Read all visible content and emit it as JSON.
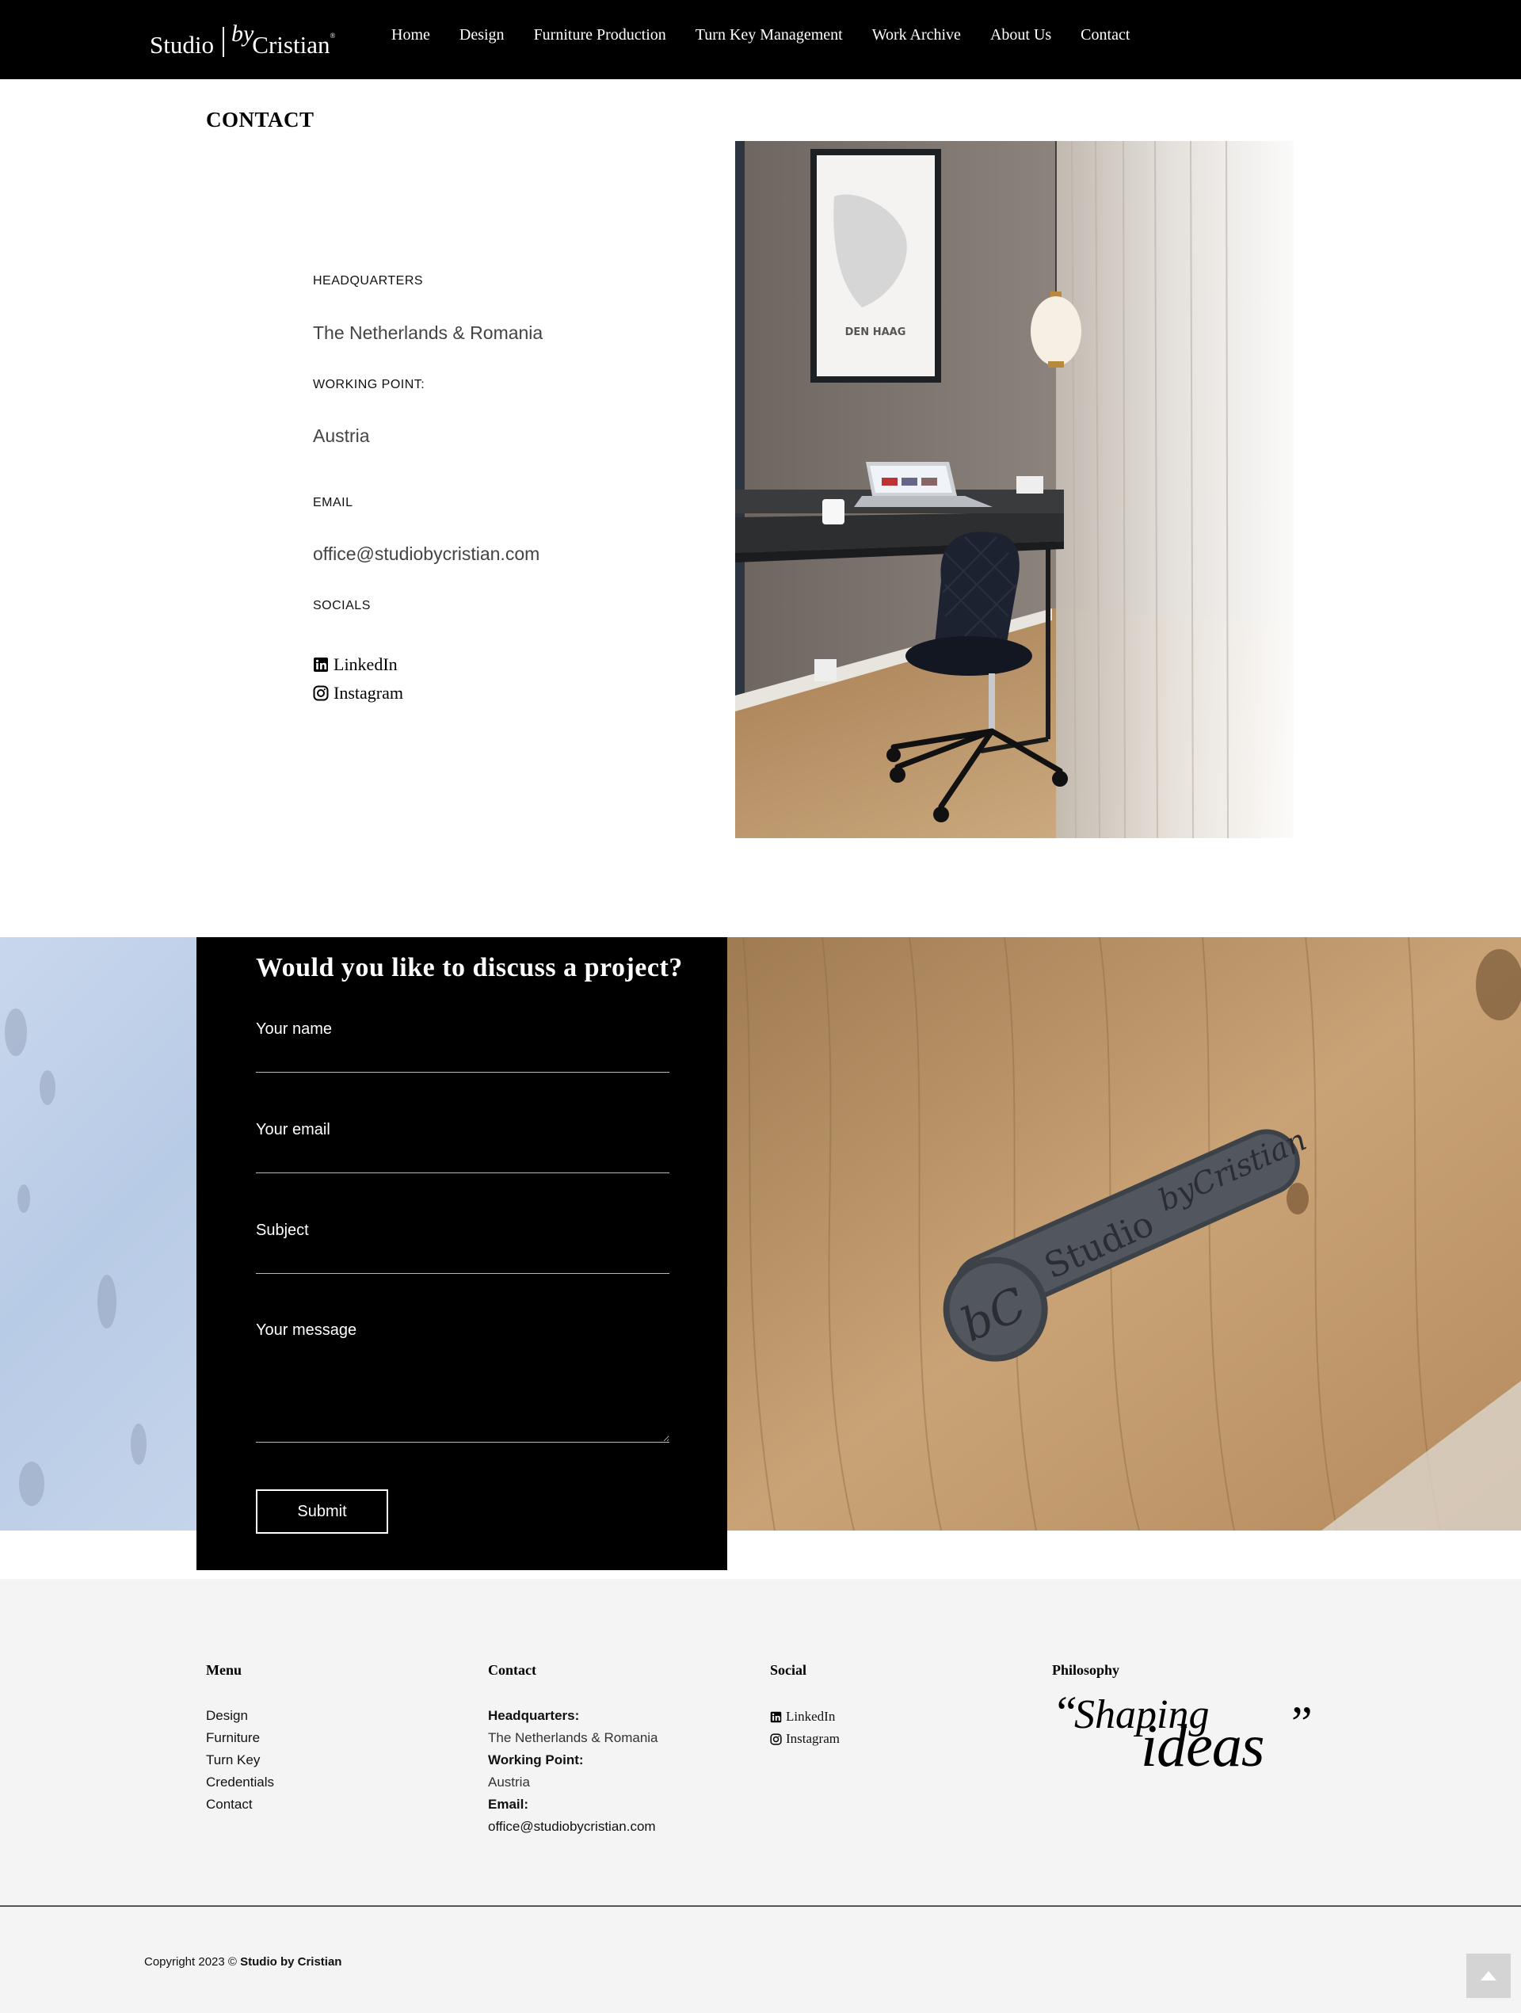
{
  "header": {
    "logo": {
      "studio": "Studio",
      "by": "by",
      "cristian": "Cristian",
      "registered": "®"
    },
    "nav": [
      "Home",
      "Design",
      "Furniture Production",
      "Turn Key Management",
      "Work Archive",
      "About Us",
      "Contact"
    ]
  },
  "contact": {
    "title": "CONTACT",
    "headquarters_label": "HEADQUARTERS",
    "headquarters_value": "The Netherlands & Romania",
    "working_point_label": "WORKING POINT:",
    "working_point_value": "Austria",
    "email_label": "EMAIL",
    "email_value": "office@studiobycristian.com",
    "socials_label": "SOCIALS",
    "socials": [
      {
        "label": "LinkedIn",
        "icon": "linkedin-icon"
      },
      {
        "label": "Instagram",
        "icon": "instagram-icon"
      }
    ],
    "photo": {
      "poster_title": "DEN HAAG",
      "subject": "desk-with-laptop-and-chair"
    }
  },
  "project": {
    "title": "Would you like to discuss a project?",
    "fields": {
      "name": {
        "label": "Your name",
        "value": ""
      },
      "email": {
        "label": "Your email",
        "value": ""
      },
      "subject": {
        "label": "Subject",
        "value": ""
      },
      "message": {
        "label": "Your message",
        "value": ""
      }
    },
    "submit_label": "Submit",
    "badge": {
      "line1": "Studio",
      "line2": "byCristian"
    }
  },
  "footer": {
    "menu": {
      "heading": "Menu",
      "items": [
        "Design",
        "Furniture",
        "Turn Key",
        "Credentials",
        "Contact"
      ]
    },
    "contact": {
      "heading": "Contact",
      "headquarters_label": "Headquarters:",
      "headquarters_value": "The Netherlands & Romania",
      "working_point_label": "Working Point:",
      "working_point_value": "Austria",
      "email_label": "Email:",
      "email_value": "office@studiobycristian.com"
    },
    "social": {
      "heading": "Social",
      "items": [
        {
          "label": "LinkedIn",
          "icon": "linkedin-icon"
        },
        {
          "label": "Instagram",
          "icon": "instagram-icon"
        }
      ]
    },
    "philosophy": {
      "heading": "Philosophy",
      "open_quote": "“",
      "word1": "Shaping",
      "word2": "ideas",
      "close_quote": "”"
    },
    "copyright_prefix": "Copyright 2023 ©",
    "copyright_brand": "Studio by Cristian"
  },
  "colors": {
    "header_bg": "#000000",
    "form_bg": "#000000",
    "footer_bg": "#f4f4f4",
    "wood": "#b08a5e",
    "marble": "#c4d4ea"
  }
}
